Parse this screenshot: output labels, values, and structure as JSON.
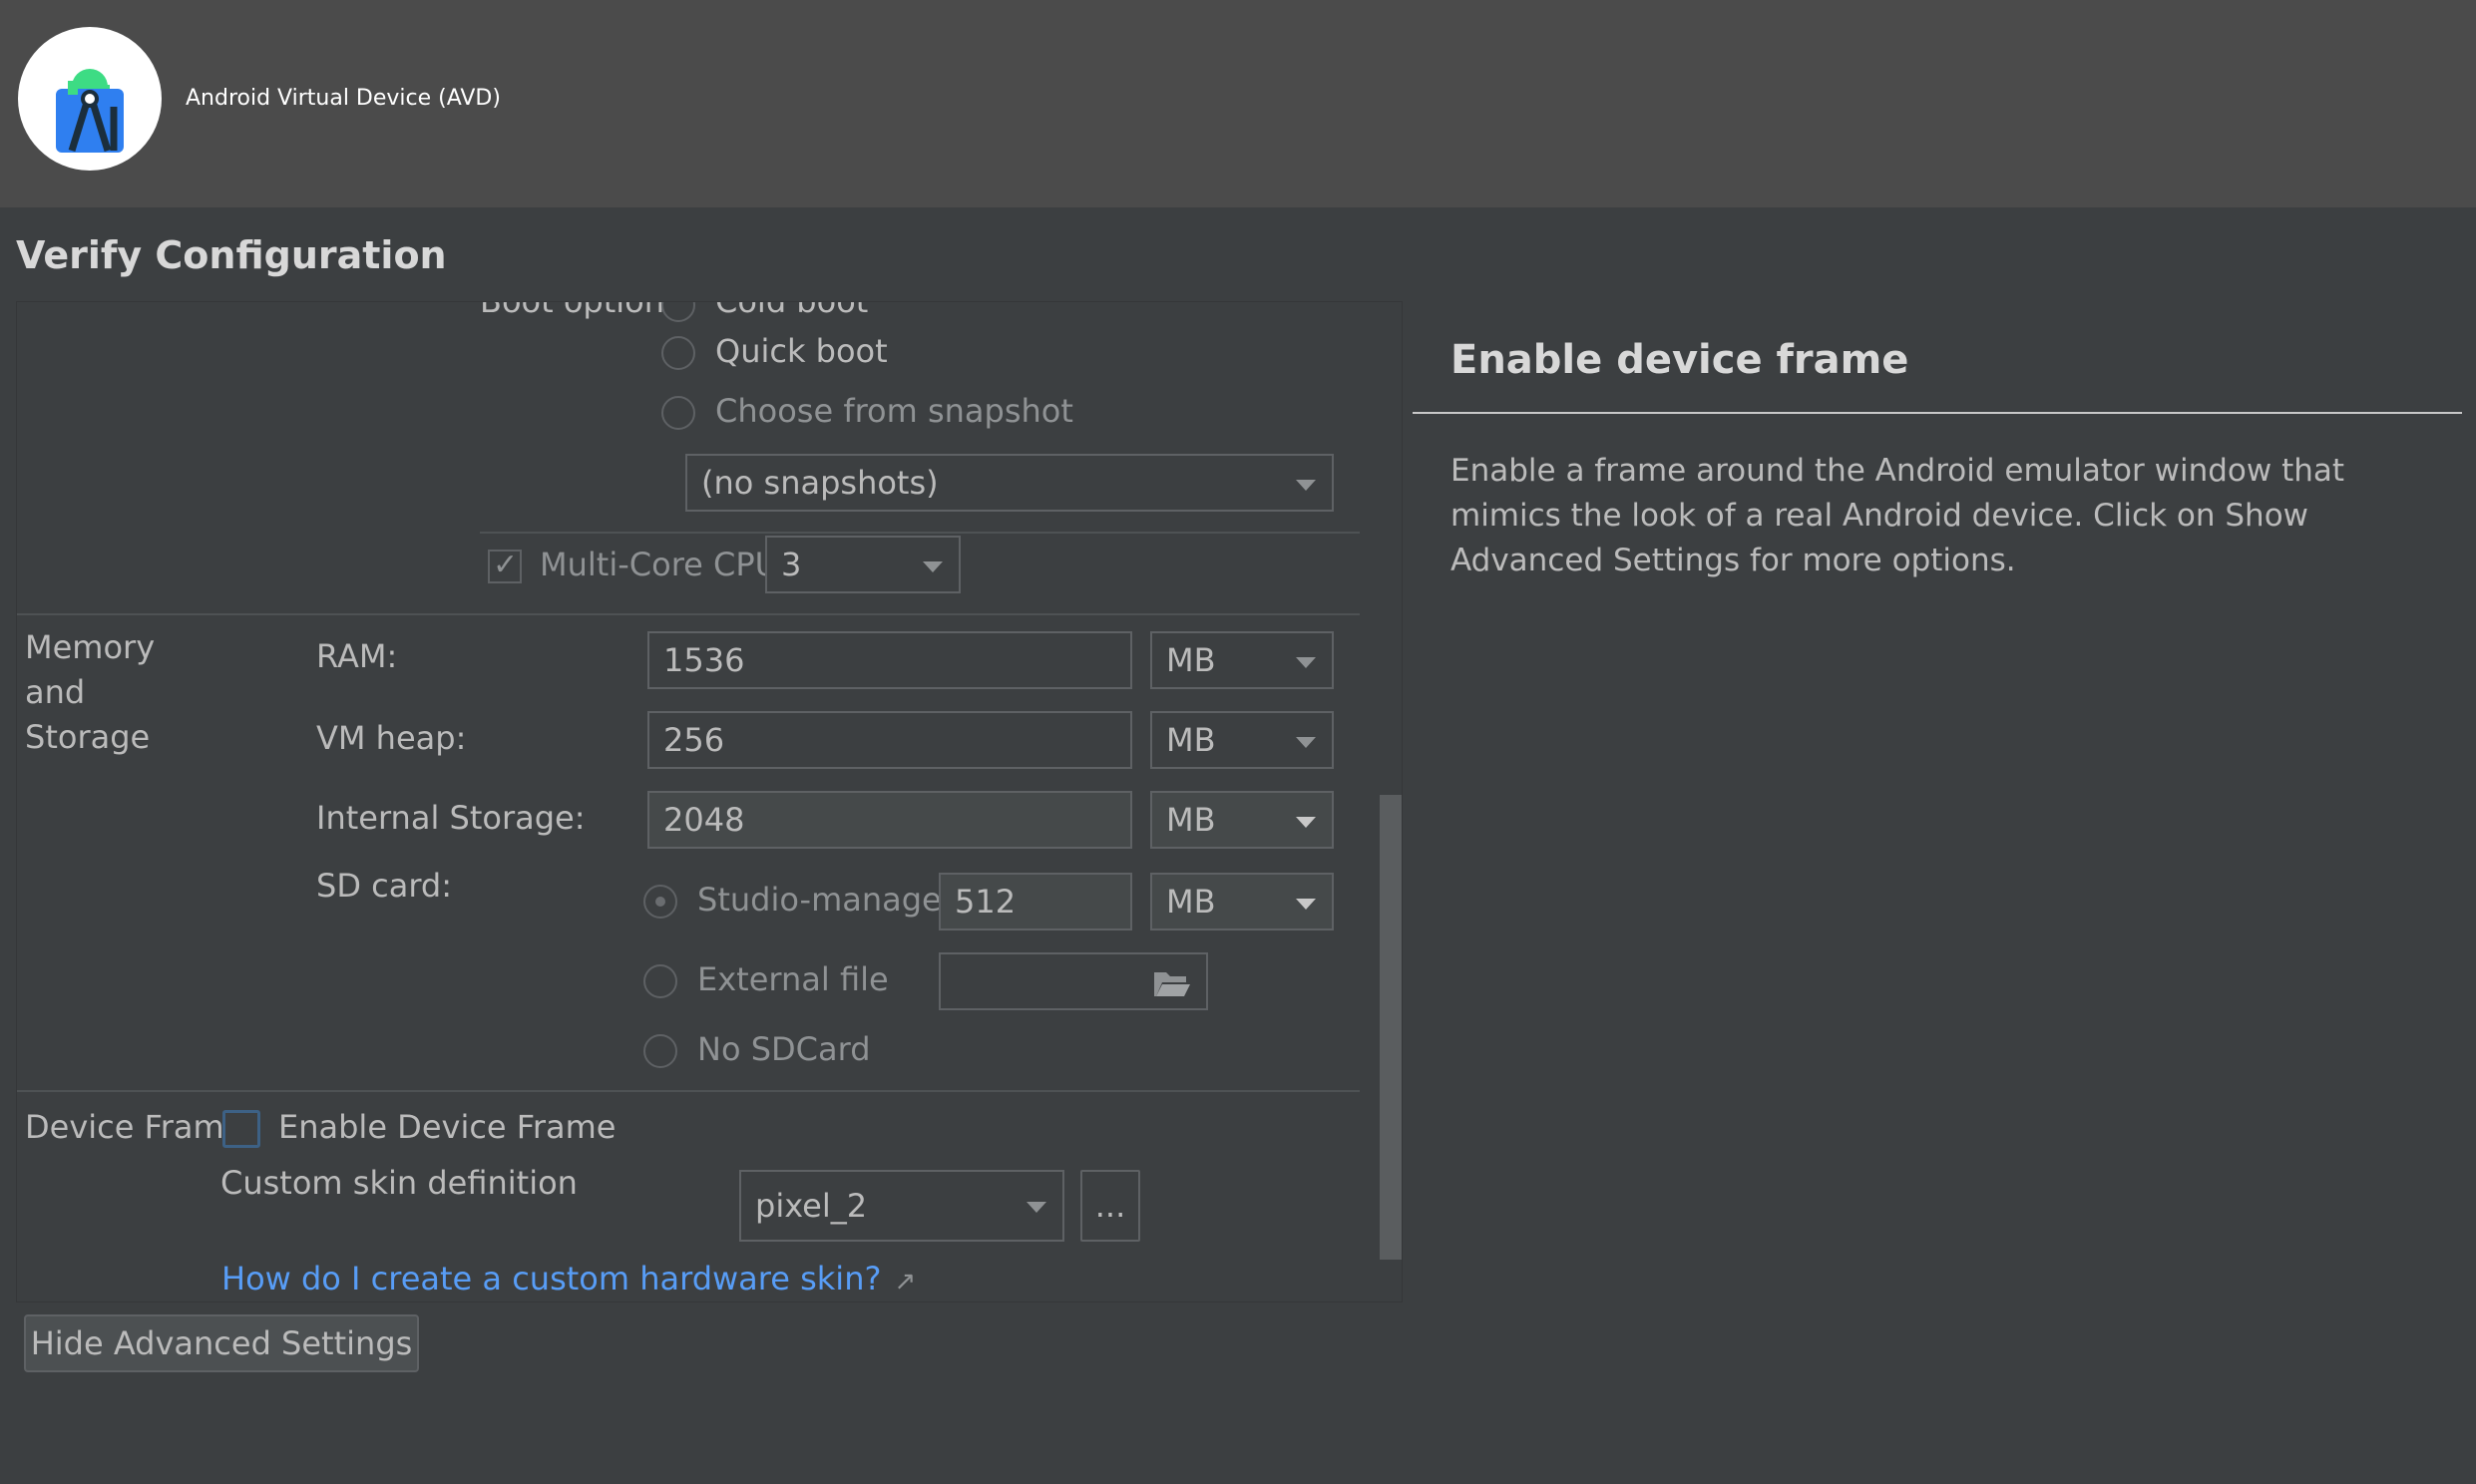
{
  "window": {
    "app_title": "Android Virtual Device (AVD)",
    "logo_icon": "android-studio-logo"
  },
  "page_title": "Verify Configuration",
  "emulated_performance": {
    "boot_option_label": "Boot option:",
    "boot_options": [
      "Cold boot",
      "Quick boot",
      "Choose from snapshot"
    ],
    "snapshot_select": "(no snapshots)",
    "multicore_label": "Multi-Core CPU",
    "multicore_checked": true,
    "multicore_value": "3"
  },
  "memory": {
    "section_label_lines": [
      "Memory",
      "and",
      "Storage"
    ],
    "ram_label": "RAM:",
    "ram_value": "1536",
    "ram_unit": "MB",
    "vm_heap_label": "VM heap:",
    "vm_heap_value": "256",
    "vm_heap_unit": "MB",
    "internal_label": "Internal Storage:",
    "internal_value": "2048",
    "internal_unit": "MB",
    "sd_label": "SD card:",
    "sd_studio_label": "Studio-managed",
    "sd_value": "512",
    "sd_unit": "MB",
    "sd_external_label": "External file",
    "sd_external_value": "",
    "sd_none_label": "No SDCard",
    "folder_icon": "folder-open-icon"
  },
  "device_frame": {
    "section_label": "Device Frame",
    "enable_label": "Enable Device Frame",
    "enable_checked": false,
    "skin_label": "Custom skin definition",
    "skin_value": "pixel_2",
    "browse_label": "...",
    "help_link": "How do I create a custom hardware skin?",
    "external_link_icon": "external-link-arrow-icon"
  },
  "footer": {
    "hide_advanced_button": "Hide Advanced Settings"
  },
  "help_panel": {
    "title": "Enable device frame",
    "body": "Enable a frame around the Android emulator window that mimics the look of a real Android device. Click on Show Advanced Settings for more options."
  }
}
